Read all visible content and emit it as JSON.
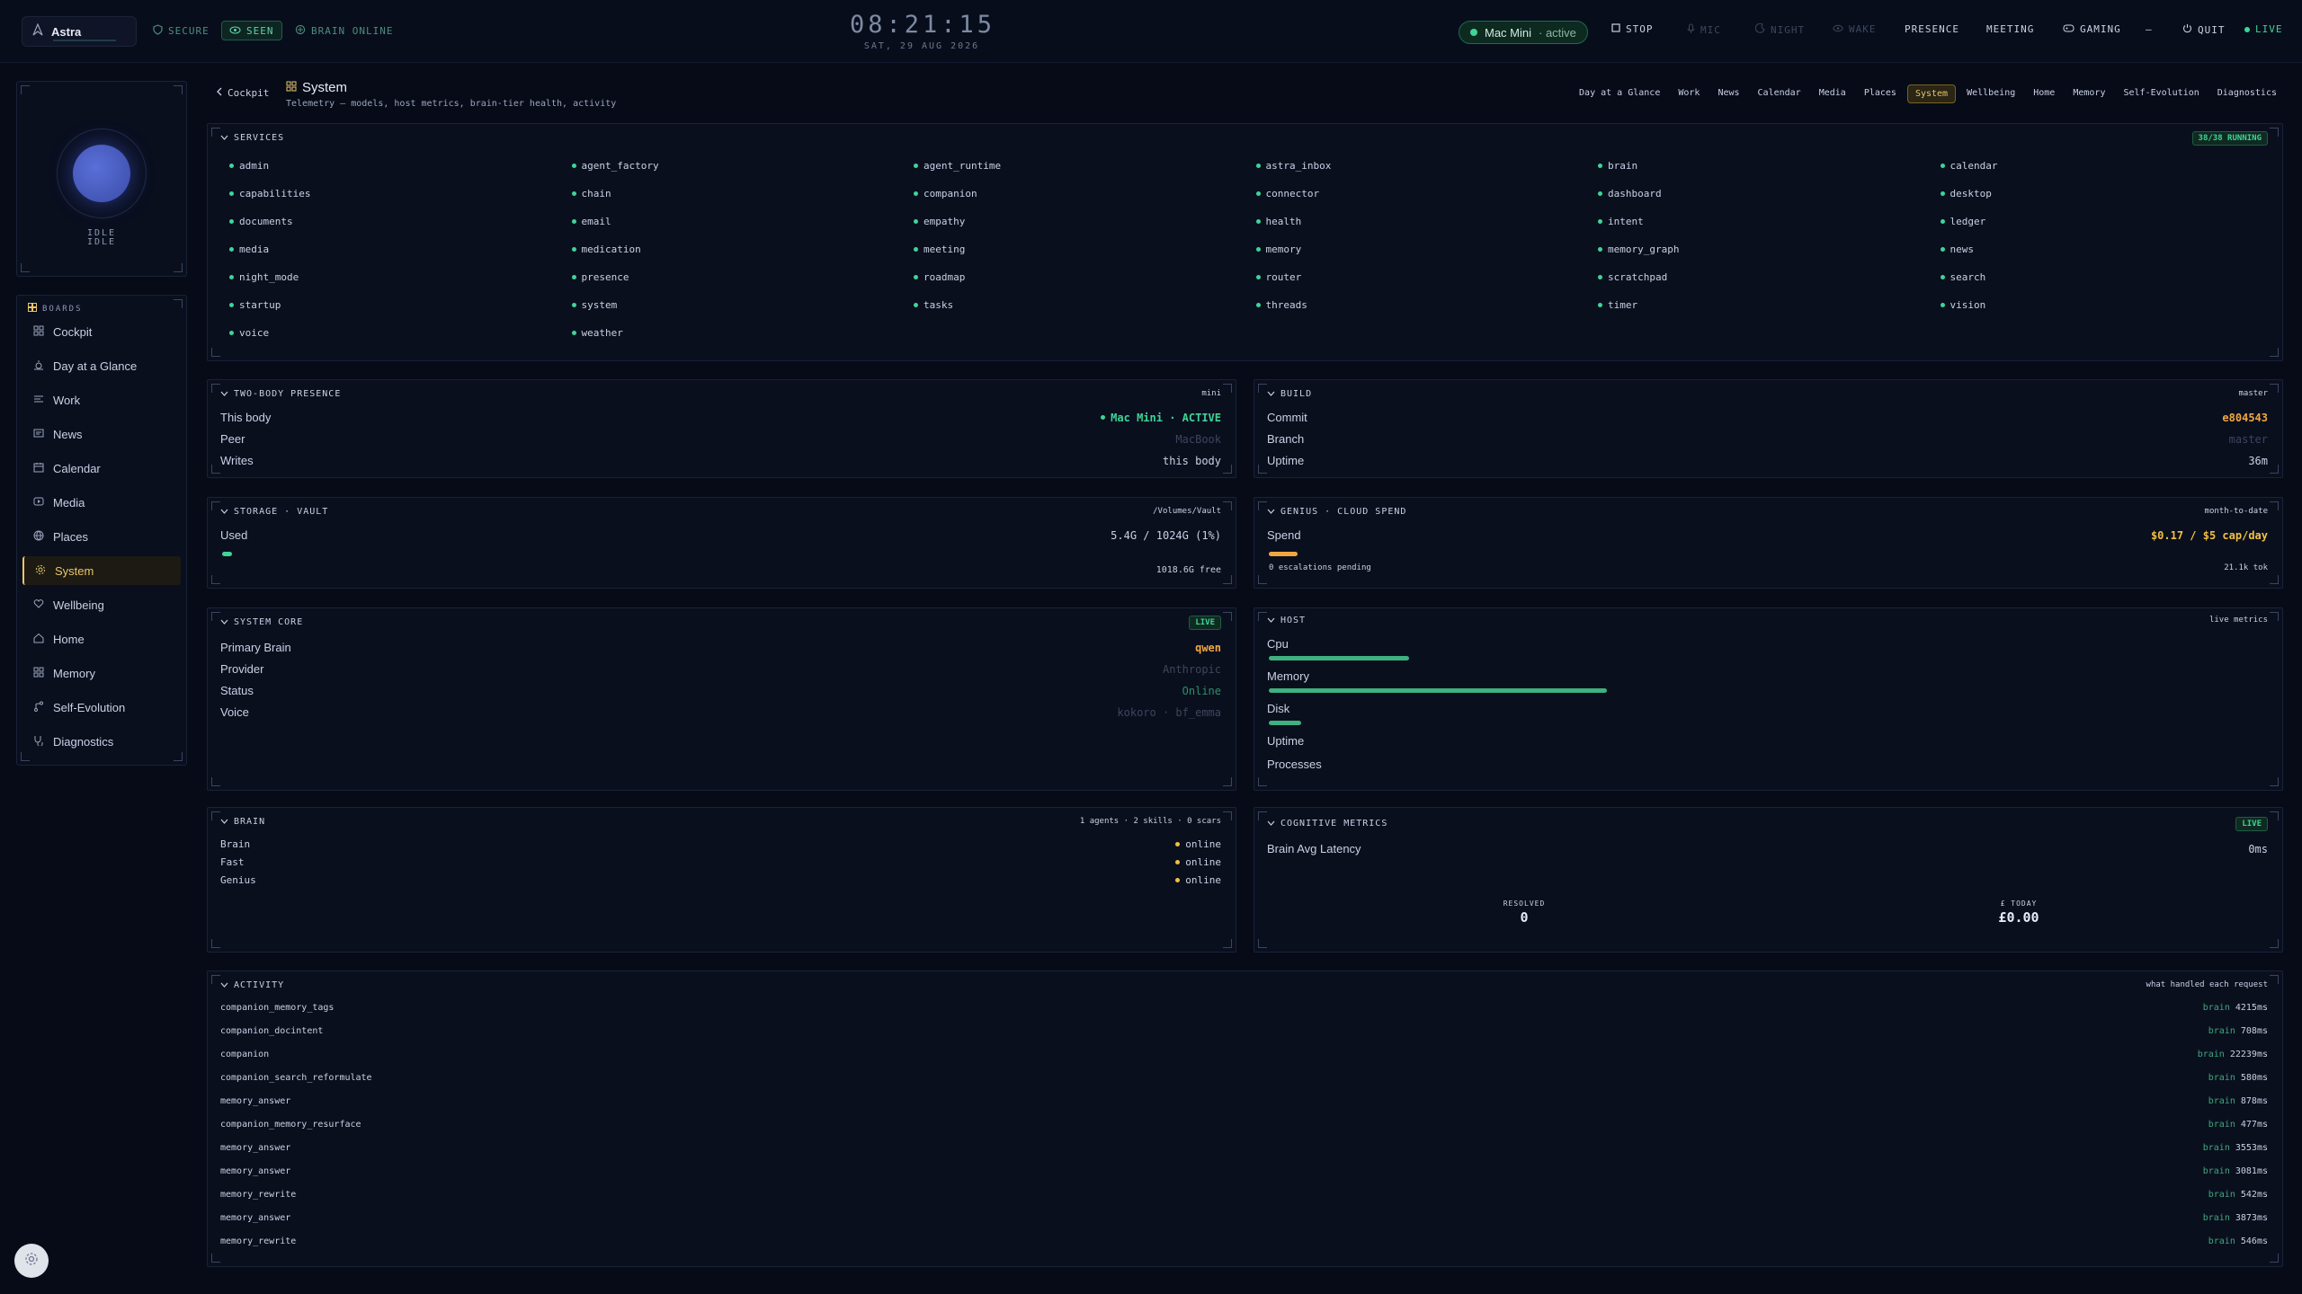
{
  "app": {
    "name": "Astra"
  },
  "top": {
    "secure": "SECURE",
    "seen": "SEEN",
    "brain_online": "BRAIN ONLINE",
    "clock": "08:21:15",
    "date": "SAT, 29 AUG 2026",
    "host_name": "Mac Mini",
    "host_state": "· active",
    "stop": "STOP",
    "mic": "MIC",
    "night": "NIGHT",
    "wake": "WAKE",
    "presence": "PRESENCE",
    "meeting": "MEETING",
    "gaming": "GAMING",
    "minimize": "—",
    "quit": "QUIT",
    "live": "LIVE"
  },
  "avatar": {
    "state1": "IDLE",
    "state2": "IDLE"
  },
  "nav": {
    "header": "BOARDS",
    "items": [
      "Cockpit",
      "Day at a Glance",
      "Work",
      "News",
      "Calendar",
      "Media",
      "Places",
      "System",
      "Wellbeing",
      "Home",
      "Memory",
      "Self-Evolution",
      "Diagnostics"
    ],
    "active": "System"
  },
  "page": {
    "back": "Cockpit",
    "title": "System",
    "subtitle": "Telemetry — models, host metrics, brain-tier health, activity"
  },
  "tabs": [
    "Day at a Glance",
    "Work",
    "News",
    "Calendar",
    "Media",
    "Places",
    "System",
    "Wellbeing",
    "Home",
    "Memory",
    "Self-Evolution",
    "Diagnostics"
  ],
  "services": {
    "title": "SERVICES",
    "badge": "38/38 RUNNING",
    "items": [
      "admin",
      "agent_factory",
      "agent_runtime",
      "astra_inbox",
      "brain",
      "calendar",
      "capabilities",
      "chain",
      "companion",
      "connector",
      "dashboard",
      "desktop",
      "documents",
      "email",
      "empathy",
      "health",
      "intent",
      "ledger",
      "media",
      "medication",
      "meeting",
      "memory",
      "memory_graph",
      "news",
      "night_mode",
      "presence",
      "roadmap",
      "router",
      "scratchpad",
      "search",
      "startup",
      "system",
      "tasks",
      "threads",
      "timer",
      "vision",
      "voice",
      "weather"
    ]
  },
  "presence": {
    "title": "TWO-BODY PRESENCE",
    "tag": "mini",
    "rows": [
      {
        "k": "This body",
        "v": "Mac Mini · ACTIVE"
      },
      {
        "k": "Peer",
        "v": "MacBook"
      },
      {
        "k": "Writes",
        "v": "this body"
      }
    ]
  },
  "build": {
    "title": "BUILD",
    "tag": "master",
    "rows": [
      {
        "k": "Commit",
        "v": "e804543"
      },
      {
        "k": "Branch",
        "v": "master"
      },
      {
        "k": "Uptime",
        "v": "36m"
      }
    ]
  },
  "storage": {
    "title": "STORAGE · VAULT",
    "tag": "/Volumes/Vault",
    "label": "Used",
    "value": "5.4G / 1024G (1%)",
    "used_fraction": 0.01,
    "free": "1018.6G free"
  },
  "genius": {
    "title": "GENIUS · CLOUD SPEND",
    "tag": "month-to-date",
    "label": "Spend",
    "value": "$0.17 / $5 cap/day",
    "spend_fraction": 0.034,
    "escalations": "0 escalations pending",
    "tokens": "21.1k tok"
  },
  "core": {
    "title": "SYSTEM CORE",
    "badge": "LIVE",
    "rows": [
      {
        "k": "Primary Brain",
        "v": "qwen"
      },
      {
        "k": "Provider",
        "v": "Anthropic"
      },
      {
        "k": "Status",
        "v": "Online"
      },
      {
        "k": "Voice",
        "v": "kokoro · bf_emma"
      }
    ]
  },
  "hostm": {
    "title": "HOST",
    "tag": "live metrics",
    "cpu": "Cpu",
    "cpu_fraction": 0.22,
    "memory": "Memory",
    "memory_fraction": 0.53,
    "disk": "Disk",
    "disk_fraction": 0.05,
    "uptime": "Uptime",
    "processes": "Processes"
  },
  "brain": {
    "title": "BRAIN",
    "tag": "1 agents · 2 skills · 0 scars",
    "rows": [
      {
        "k": "Brain",
        "v": "online"
      },
      {
        "k": "Fast",
        "v": "online"
      },
      {
        "k": "Genius",
        "v": "online"
      }
    ]
  },
  "cognitive": {
    "title": "COGNITIVE METRICS",
    "badge": "LIVE",
    "latency_label": "Brain Avg Latency",
    "latency": "0ms",
    "resolved_label": "RESOLVED",
    "resolved": "0",
    "today_label": "£ TODAY",
    "today": "£0.00"
  },
  "activity": {
    "title": "ACTIVITY",
    "tag": "what handled each request",
    "rows": [
      {
        "name": "companion_memory_tags",
        "by": "brain",
        "ms": "4215ms"
      },
      {
        "name": "companion_docintent",
        "by": "brain",
        "ms": "708ms"
      },
      {
        "name": "companion",
        "by": "brain",
        "ms": "22239ms"
      },
      {
        "name": "companion_search_reformulate",
        "by": "brain",
        "ms": "580ms"
      },
      {
        "name": "memory_answer",
        "by": "brain",
        "ms": "878ms"
      },
      {
        "name": "companion_memory_resurface",
        "by": "brain",
        "ms": "477ms"
      },
      {
        "name": "memory_answer",
        "by": "brain",
        "ms": "3553ms"
      },
      {
        "name": "memory_answer",
        "by": "brain",
        "ms": "3081ms"
      },
      {
        "name": "memory_rewrite",
        "by": "brain",
        "ms": "542ms"
      },
      {
        "name": "memory_answer",
        "by": "brain",
        "ms": "3873ms"
      },
      {
        "name": "memory_rewrite",
        "by": "brain",
        "ms": "546ms"
      }
    ]
  },
  "colors": {
    "accent": "#e8c66a",
    "ok": "#3ed597",
    "warn": "#f0a742",
    "bg": "#070b18"
  }
}
